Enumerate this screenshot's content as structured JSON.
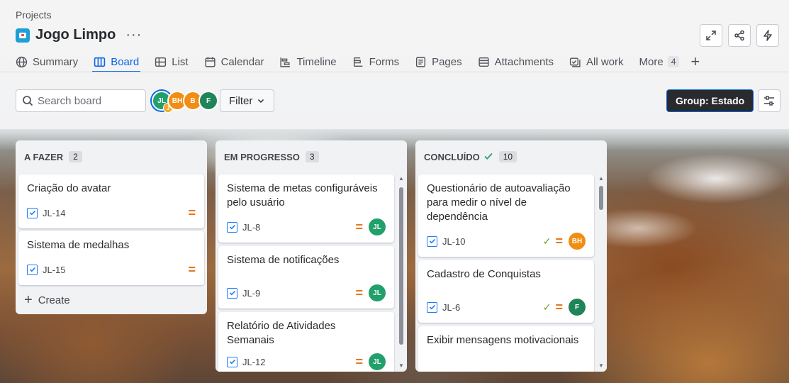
{
  "header": {
    "breadcrumb": "Projects",
    "title": "Jogo Limpo",
    "more": "···"
  },
  "tabs": [
    {
      "label": "Summary",
      "icon": "globe-icon"
    },
    {
      "label": "Board",
      "icon": "board-icon",
      "active": true
    },
    {
      "label": "List",
      "icon": "list-icon"
    },
    {
      "label": "Calendar",
      "icon": "calendar-icon"
    },
    {
      "label": "Timeline",
      "icon": "timeline-icon"
    },
    {
      "label": "Forms",
      "icon": "forms-icon"
    },
    {
      "label": "Pages",
      "icon": "pages-icon"
    },
    {
      "label": "Attachments",
      "icon": "attachments-icon"
    },
    {
      "label": "All work",
      "icon": "all-work-icon"
    },
    {
      "label": "More",
      "count": "4"
    }
  ],
  "toolbar": {
    "search_placeholder": "Search board",
    "filter_label": "Filter",
    "group_label": "Group: Estado",
    "avatars": [
      "JL",
      "BH",
      "B",
      "F"
    ],
    "avatar_sub": "J"
  },
  "colors": {
    "accent": "#0c66e4",
    "priority_medium": "#e2791b",
    "jl_avatar": "#22a06b",
    "bh_avatar": "#f18d13",
    "f_avatar": "#1f845a"
  },
  "columns": [
    {
      "name": "A FAZER",
      "count": "2",
      "create_label": "Create",
      "cards": [
        {
          "title": "Criação do avatar",
          "key": "JL-14"
        },
        {
          "title": "Sistema de medalhas",
          "key": "JL-15"
        }
      ]
    },
    {
      "name": "EM PROGRESSO",
      "count": "3",
      "cards": [
        {
          "title": "Sistema de metas configuráveis pelo usuário",
          "key": "JL-8",
          "assignee": "JL"
        },
        {
          "title": "Sistema de notificações",
          "key": "JL-9",
          "assignee": "JL"
        },
        {
          "title": "Relatório de Atividades Semanais",
          "key": "JL-12",
          "assignee": "JL"
        }
      ]
    },
    {
      "name": "CONCLUÍDO",
      "count": "10",
      "cards": [
        {
          "title": "Questionário de autoavaliação para medir o nível de dependência",
          "key": "JL-10",
          "assignee": "BH"
        },
        {
          "title": "Cadastro de Conquistas",
          "key": "JL-6",
          "assignee": "F"
        },
        {
          "title": "Exibir mensagens motivacionais",
          "key": ""
        }
      ]
    }
  ]
}
